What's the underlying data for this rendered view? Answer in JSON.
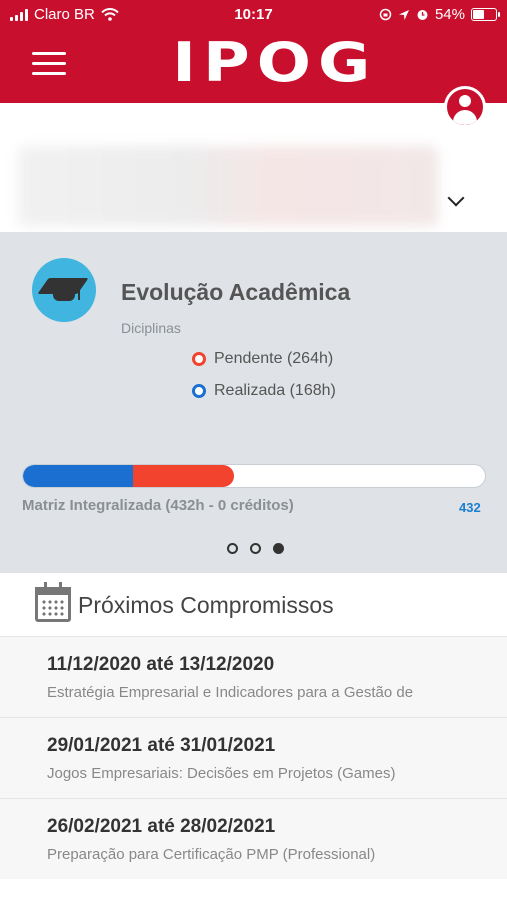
{
  "status_bar": {
    "carrier": "Claro BR",
    "time": "10:17",
    "battery": "54%",
    "battery_level": 0.54
  },
  "header": {
    "logo_text": "IPOG",
    "brand_color": "#c8102e"
  },
  "academic": {
    "title": "Evolução Acadêmica",
    "subtitle": "Diciplinas",
    "pending_label": "Pendente (264h)",
    "done_label": "Realizada (168h)",
    "pending_hours": 264,
    "done_hours": 168,
    "matrix_label": "Matriz Integralizada (432h - 0 créditos)",
    "total": "432",
    "pending_color": "#f2432f",
    "done_color": "#1a6fd1",
    "carousel_pages": 3,
    "carousel_active": 3
  },
  "upcoming": {
    "title": "Próximos Compromissos",
    "items": [
      {
        "date": "11/12/2020 até 13/12/2020",
        "desc": "Estratégia Empresarial e Indicadores para a Gestão de"
      },
      {
        "date": "29/01/2021 até 31/01/2021",
        "desc": "Jogos Empresariais: Decisões em Projetos (Games)"
      },
      {
        "date": "26/02/2021 até 28/02/2021",
        "desc": "Preparação para Certificação PMP (Professional)"
      }
    ]
  }
}
